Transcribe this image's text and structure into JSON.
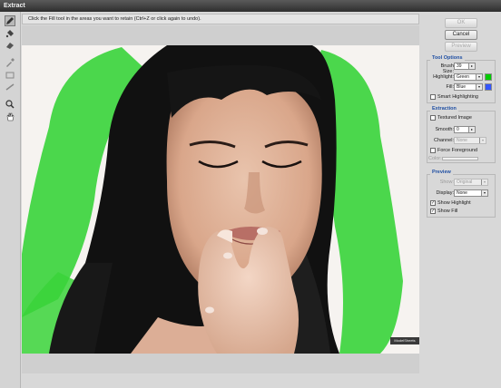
{
  "window": {
    "title": "Extract"
  },
  "toolbar": {
    "tools": [
      {
        "name": "edge-highlighter-tool",
        "icon": "pencil-icon",
        "active": true
      },
      {
        "name": "fill-tool",
        "icon": "paint-bucket-icon"
      },
      {
        "name": "eraser-tool",
        "icon": "eraser-icon"
      },
      {
        "name": "eyedropper-tool",
        "icon": "eyedropper-icon"
      },
      {
        "name": "cleanup-tool",
        "icon": "cleanup-icon"
      },
      {
        "name": "edge-touchup-tool",
        "icon": "touchup-icon"
      },
      {
        "name": "zoom-tool",
        "icon": "magnifier-icon"
      },
      {
        "name": "hand-tool",
        "icon": "hand-icon"
      }
    ]
  },
  "instructions": "Click the Fill tool in the areas you want to retain (Ctrl+Z or click again to undo).",
  "buttons": {
    "ok": "OK",
    "cancel": "Cancel",
    "preview": "Preview"
  },
  "tool_options": {
    "title": "Tool Options",
    "brush_size_label": "Brush Size:",
    "brush_size_value": "39",
    "highlight_label": "Highlight:",
    "highlight_value": "Green",
    "highlight_color": "#00cc00",
    "fill_label": "Fill:",
    "fill_value": "Blue",
    "fill_color": "#3355ff",
    "smart_highlighting_label": "Smart Highlighting",
    "smart_highlighting_checked": false
  },
  "extraction": {
    "title": "Extraction",
    "textured_image_label": "Textured Image",
    "smooth_label": "Smooth:",
    "smooth_value": "0",
    "channel_label": "Channel:",
    "channel_value": "None",
    "force_foreground_label": "Force Foreground",
    "color_label": "Color:"
  },
  "preview": {
    "title": "Preview",
    "show_label": "Show:",
    "show_value": "Original",
    "display_label": "Display:",
    "display_value": "None",
    "show_highlight_label": "Show Highlight",
    "show_highlight_checked": true,
    "show_fill_label": "Show Fill",
    "show_fill_checked": true
  },
  "canvas": {
    "watermark": "ModelSheets"
  }
}
